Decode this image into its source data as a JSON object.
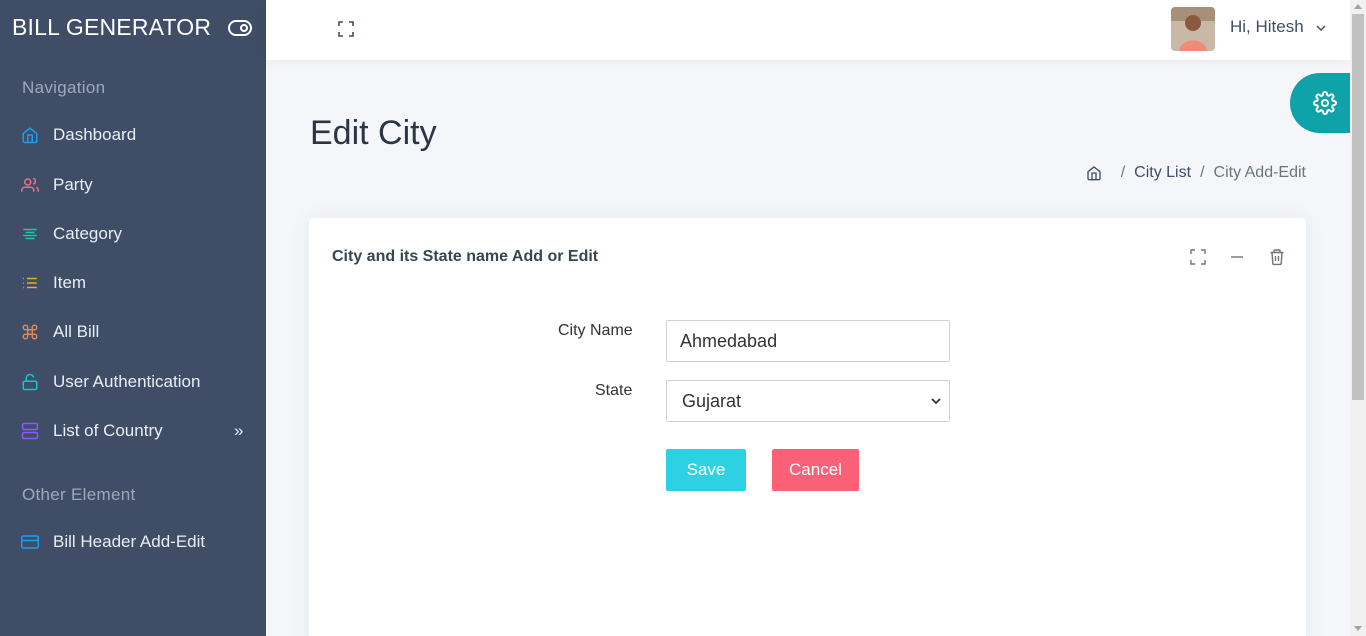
{
  "sidebar": {
    "brand": "BILL GENERATOR",
    "captions": {
      "navigation": "Navigation",
      "other": "Other Element"
    },
    "items": [
      {
        "label": "Dashboard",
        "icon": "home-icon",
        "color": "#1e9bf0"
      },
      {
        "label": "Party",
        "icon": "users-icon",
        "color": "#f06d8a"
      },
      {
        "label": "Category",
        "icon": "align-center-icon",
        "color": "#22c4a0"
      },
      {
        "label": "Item",
        "icon": "list-icon",
        "color": "#f5a623"
      },
      {
        "label": "All Bill",
        "icon": "command-icon",
        "color": "#d98a5b"
      },
      {
        "label": "User Authentication",
        "icon": "unlock-icon",
        "color": "#1ec3c9"
      },
      {
        "label": "List of Country",
        "icon": "server-icon",
        "color": "#8a5cf6",
        "arrow": "»"
      },
      {
        "label": "Bill Header Add-Edit",
        "icon": "credit-card-icon",
        "color": "#1e9bf0"
      }
    ]
  },
  "header": {
    "greeting": "Hi, Hitesh"
  },
  "page": {
    "title": "Edit City",
    "breadcrumb": {
      "sep": "/",
      "link": "City List",
      "current": "City Add-Edit"
    }
  },
  "card": {
    "title": "City and its State name Add or Edit",
    "form": {
      "city_label": "City Name",
      "city_value": "Ahmedabad",
      "state_label": "State",
      "state_value": "Gujarat"
    },
    "save_label": "Save",
    "cancel_label": "Cancel"
  },
  "colors": {
    "sidebar": "#3f4d67",
    "accent": "#0fa2a8",
    "save": "#2ed1e3",
    "cancel": "#fa6176"
  }
}
